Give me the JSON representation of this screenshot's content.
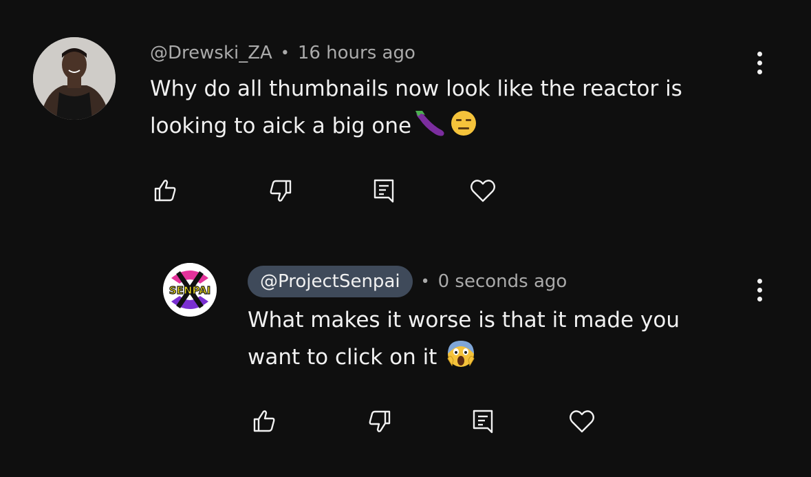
{
  "comment": {
    "author": "@Drewski_ZA",
    "separator": "•",
    "time": "16 hours ago",
    "text_line1": "Why do all thumbnails now look like the reactor is",
    "text_line2": "looking to aick a big one",
    "emojis": [
      "eggplant-emoji",
      "expressionless-face-emoji"
    ]
  },
  "reply": {
    "author": "@ProjectSenpai",
    "separator": "•",
    "time": "0 seconds ago",
    "text_line1": "What makes it worse is that it made you",
    "text_line2": "want to click on it",
    "emojis": [
      "face-screaming-in-fear-emoji"
    ],
    "avatar_logo_text": "SENPAI"
  },
  "icons": [
    "like-icon",
    "dislike-icon",
    "reply-icon",
    "heart-icon",
    "more-vertical-icon"
  ],
  "colors": {
    "background": "#0f0f0f",
    "text": "#f1f1f1",
    "meta": "#aaaaaa",
    "author_pill": "#3f4a5a"
  }
}
